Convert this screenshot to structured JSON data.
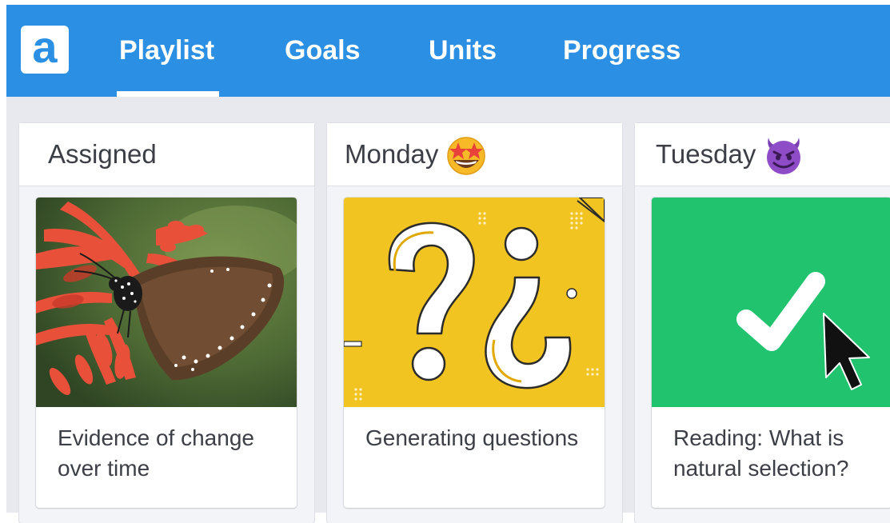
{
  "app": {
    "logo_letter": "a"
  },
  "nav": {
    "tabs": [
      {
        "label": "Playlist",
        "active": true
      },
      {
        "label": "Goals",
        "active": false
      },
      {
        "label": "Units",
        "active": false
      },
      {
        "label": "Progress",
        "active": false
      }
    ]
  },
  "columns": [
    {
      "title": "Assigned",
      "emoji": "",
      "card": {
        "title": "Evidence of change over time",
        "thumbnail": "butterfly-photo"
      }
    },
    {
      "title": "Monday",
      "emoji": "star-struck-emoji",
      "card": {
        "title": "Generating questions",
        "thumbnail": "question-marks-illustration"
      }
    },
    {
      "title": "Tuesday",
      "emoji": "smiling-devil-emoji",
      "card": {
        "title": "Reading: What is natural selection?",
        "thumbnail": "checkmark-illustration"
      }
    }
  ],
  "colors": {
    "nav_bg": "#2b8fe3",
    "board_bg": "#e7e9ee",
    "yellow_thumb": "#f2c421",
    "green_thumb": "#22c36e"
  }
}
